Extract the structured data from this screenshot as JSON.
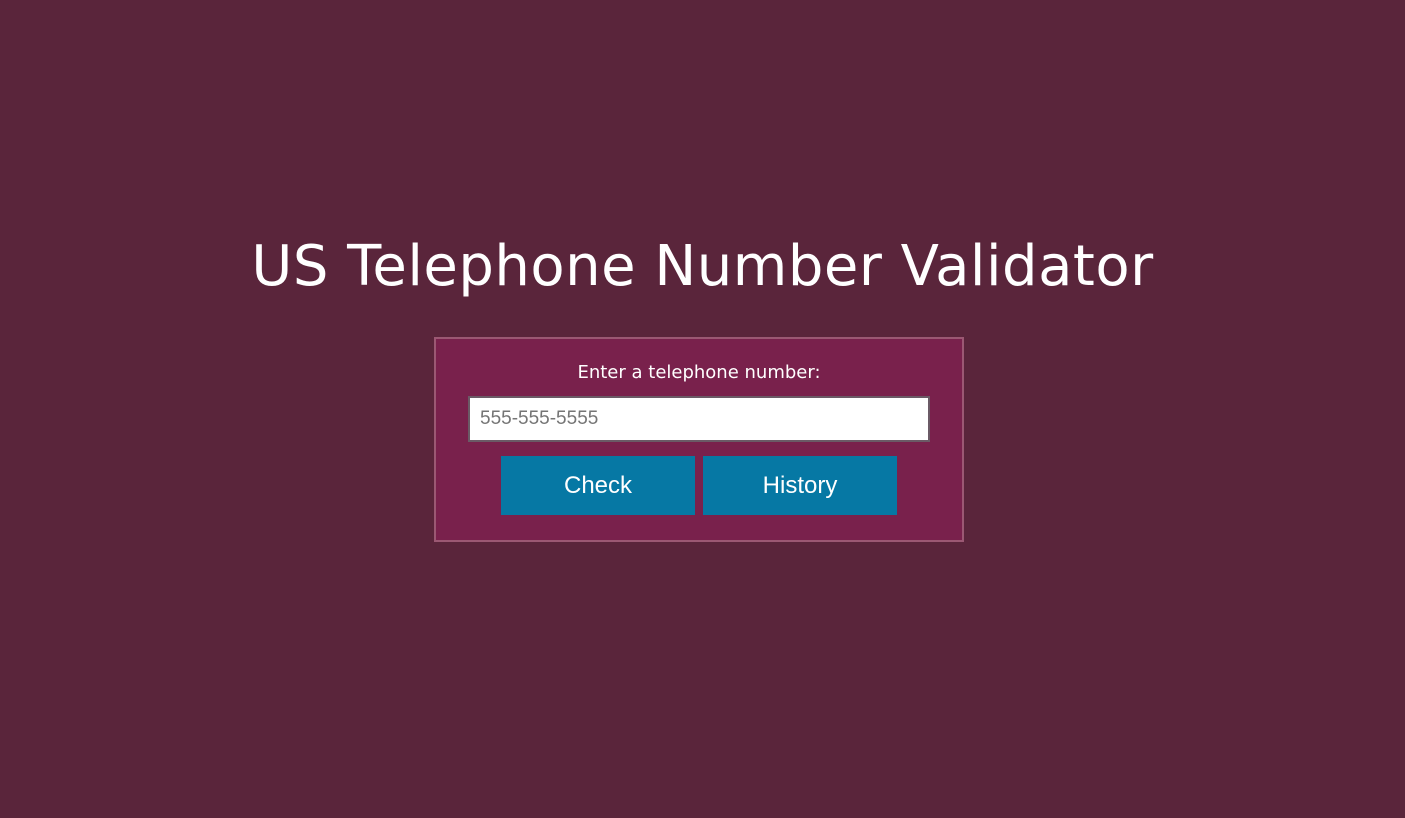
{
  "title": "US Telephone Number Validator",
  "form": {
    "prompt": "Enter a telephone number:",
    "input_value": "",
    "input_placeholder": "555-555-5555",
    "check_label": "Check",
    "history_label": "History"
  },
  "colors": {
    "background": "#5a253b",
    "panel": "#79214c",
    "button": "#0678a4",
    "text": "#ffffff"
  }
}
